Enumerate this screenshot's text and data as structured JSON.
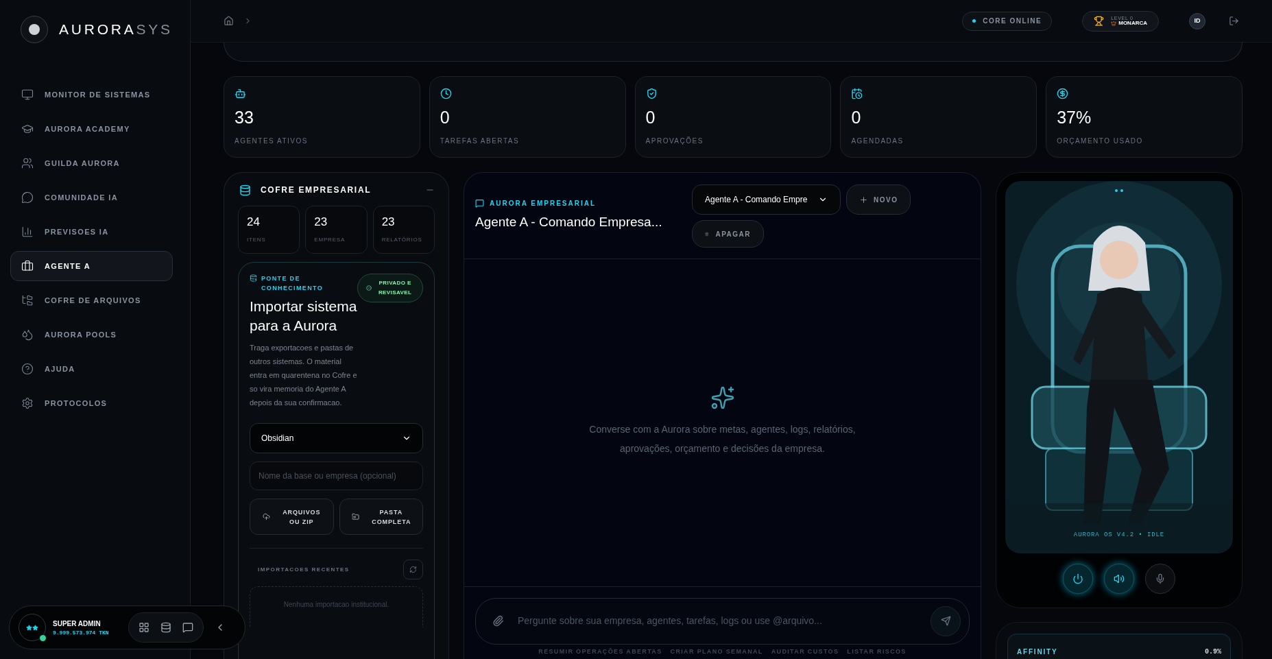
{
  "brand": {
    "primary": "AURORA",
    "secondary": "SYS"
  },
  "sidebar": {
    "items": [
      {
        "label": "MONITOR DE SISTEMAS",
        "selected": false
      },
      {
        "label": "AURORA ACADEMY",
        "selected": false
      },
      {
        "label": "GUILDA AURORA",
        "selected": false
      },
      {
        "label": "COMUNIDADE IA",
        "selected": false
      },
      {
        "label": "PREVISOES IA",
        "selected": false
      },
      {
        "label": "AGENTE A",
        "selected": true
      },
      {
        "label": "COFRE DE ARQUIVOS",
        "selected": false
      },
      {
        "label": "AURORA POOLS",
        "selected": false
      },
      {
        "label": "AJUDA",
        "selected": false
      },
      {
        "label": "PROTOCOLOS",
        "selected": false
      }
    ]
  },
  "user": {
    "name": "SUPER ADMIN",
    "tokens": "9.999.573.974 TKN",
    "online": true
  },
  "topbar": {
    "status": "CORE ONLINE",
    "level": {
      "label": "LEVEL 0",
      "rank": "MONARCA"
    },
    "avatar": "ID"
  },
  "stats": [
    {
      "value": "33",
      "label": "AGENTES ATIVOS"
    },
    {
      "value": "0",
      "label": "TAREFAS ABERTAS"
    },
    {
      "value": "0",
      "label": "APROVAÇÕES"
    },
    {
      "value": "0",
      "label": "AGENDADAS"
    },
    {
      "value": "37%",
      "label": "ORÇAMENTO USADO"
    }
  ],
  "vault": {
    "title": "COFRE EMPRESARIAL",
    "counts": [
      {
        "value": "24",
        "label": "ITENS"
      },
      {
        "value": "23",
        "label": "EMPRESA"
      },
      {
        "value": "23",
        "label": "RELATÓRIOS"
      }
    ],
    "bridge": {
      "eyebrow": "PONTE DE CONHECIMENTO",
      "badge": "PRIVADO E REVISAVEL",
      "title": "Importar sistema para a Aurora",
      "description": "Traga exportacoes e pastas de outros sistemas. O material entra em quarentena no Cofre e so vira memoria do Agente A depois da sua confirmacao.",
      "source": "Obsidian",
      "name_placeholder": "Nome da base ou empresa (opcional)",
      "buttons": [
        "ARQUIVOS OU ZIP",
        "PASTA COMPLETA"
      ],
      "recent_title": "IMPORTACOES RECENTES",
      "recent_empty": "Nenhuma importacao institucional."
    }
  },
  "chat": {
    "eyebrow": "AURORA EMPRESARIAL",
    "title": "Agente A - Comando Empresa...",
    "conversation": "Agente A - Comando Empre",
    "new_button": "NOVO",
    "delete_button": "APAGAR",
    "empty_message": "Converse com a Aurora sobre metas, agentes, logs, relatórios, aprovações, orçamento e decisões da empresa.",
    "input_placeholder": "Pergunte sobre sua empresa, agentes, tarefas, logs ou use @arquivo...",
    "suggestions": [
      "RESUMIR OPERAÇÕES ABERTAS",
      "CRIAR PLANO SEMANAL",
      "AUDITAR CUSTOS",
      "LISTAR RISCOS"
    ]
  },
  "companion": {
    "caption": "AURORA OS V4.2 • IDLE",
    "controls": [
      {
        "kind": "power",
        "on": true
      },
      {
        "kind": "volume",
        "on": true
      },
      {
        "kind": "mic",
        "on": false
      }
    ],
    "affinity": {
      "label": "AFFINITY",
      "value": "0.9%"
    }
  }
}
